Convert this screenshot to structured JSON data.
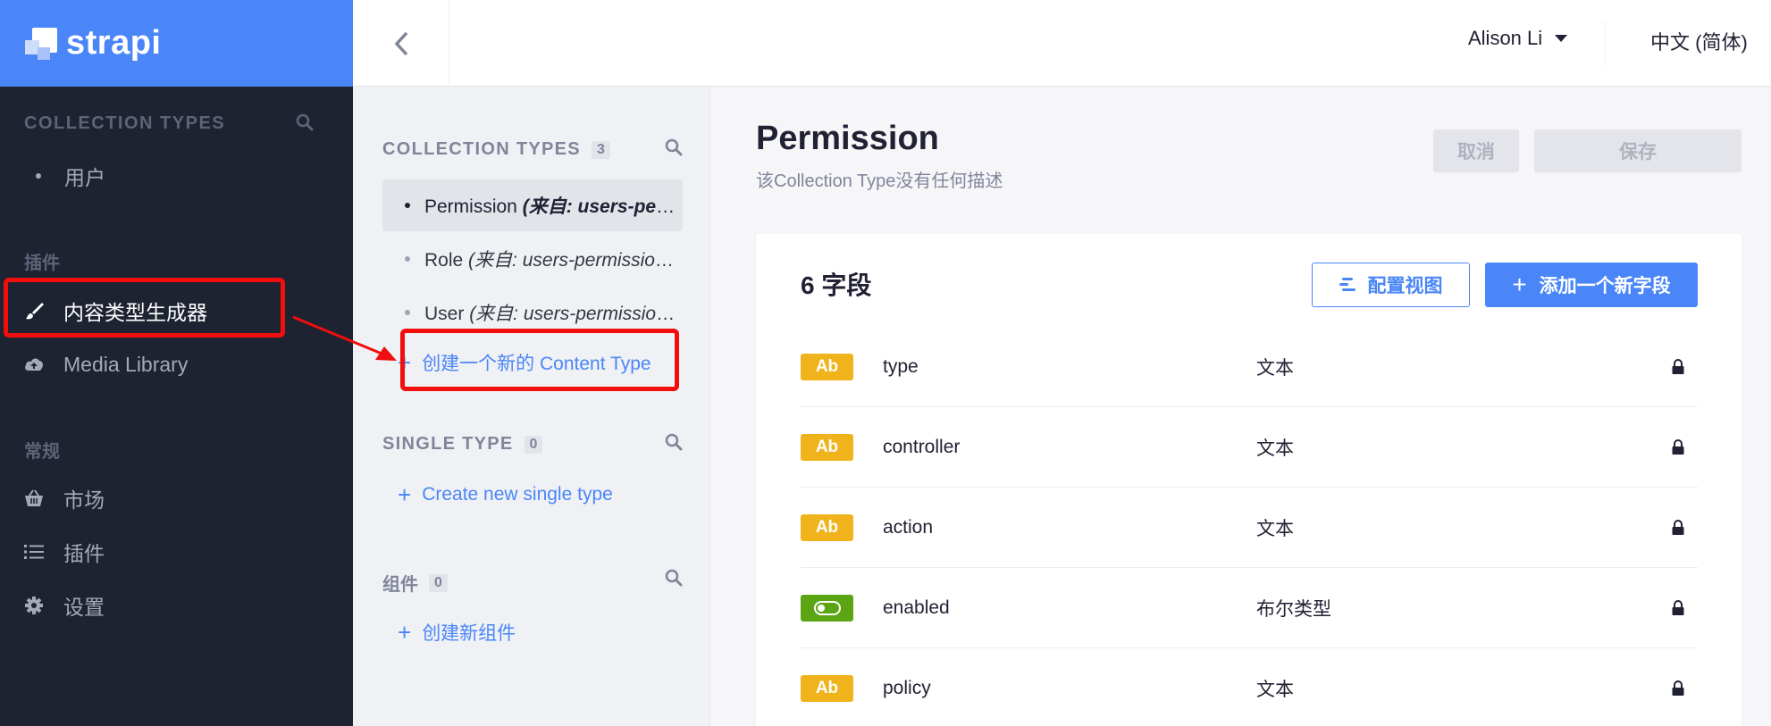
{
  "brand": {
    "name": "strapi"
  },
  "leftnav": {
    "collection_heading": "COLLECTION TYPES",
    "collection_items": [
      {
        "label": "用户"
      }
    ],
    "plugins_heading": "插件",
    "plugin_items": [
      {
        "label": "内容类型生成器",
        "icon": "paintbrush-icon",
        "active": true
      },
      {
        "label": "Media Library",
        "icon": "cloud-upload-icon",
        "active": false
      }
    ],
    "general_heading": "常规",
    "general_items": [
      {
        "label": "市场",
        "icon": "basket-icon"
      },
      {
        "label": "插件",
        "icon": "list-icon"
      },
      {
        "label": "设置",
        "icon": "gear-icon"
      }
    ]
  },
  "header": {
    "user": "Alison Li",
    "language": "中文 (简体)"
  },
  "subnav": {
    "collection_heading": "COLLECTION TYPES",
    "collection_count": "3",
    "collection_items": [
      {
        "name": "Permission",
        "origin": "(来自: users-permissions)",
        "active": true
      },
      {
        "name": "Role",
        "origin": "(来自: users-permissions)",
        "active": false
      },
      {
        "name": "User",
        "origin": "(来自: users-permissions)",
        "active": false
      }
    ],
    "create_collection": "创建一个新的 Content Type",
    "single_heading": "SINGLE TYPE",
    "single_count": "0",
    "create_single": "Create new single type",
    "components_heading": "组件",
    "components_count": "0",
    "create_component": "创建新组件"
  },
  "main": {
    "title": "Permission",
    "description": "该Collection Type没有任何描述",
    "cancel": "取消",
    "save": "保存",
    "fields_title": "6 字段",
    "configure_view": "配置视图",
    "add_field": "添加一个新字段",
    "fields": [
      {
        "badge": "Ab",
        "kind": "text",
        "name": "type",
        "type": "文本"
      },
      {
        "badge": "",
        "kind": "bool",
        "name": "controller",
        "type": "文本"
      },
      {
        "badge": "Ab",
        "kind": "text",
        "name": "action",
        "type": "文本"
      },
      {
        "badge": "",
        "kind": "bool",
        "name": "enabled",
        "type": "布尔类型"
      },
      {
        "badge": "Ab",
        "kind": "text",
        "name": "policy",
        "type": "文本"
      }
    ]
  },
  "colors": {
    "brand_blue": "#4a86f7",
    "nav_bg": "#1e2332",
    "text_badge": "#f1b31b",
    "bool_badge": "#5ba515",
    "annotation_red": "#f10e0e"
  }
}
